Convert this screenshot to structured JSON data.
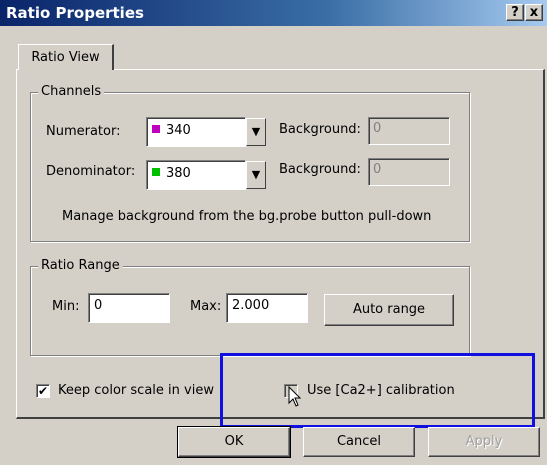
{
  "window": {
    "title": "Ratio Properties",
    "help_button": "?",
    "close_button": "x"
  },
  "tab": {
    "label": "Ratio View"
  },
  "channels": {
    "legend": "Channels",
    "numerator_label": "Numerator:",
    "numerator_value": "340",
    "numerator_color": "#c000c0",
    "numerator_bg_label": "Background:",
    "numerator_bg_value": "0",
    "denominator_label": "Denominator:",
    "denominator_value": "380",
    "denominator_color": "#00c000",
    "denominator_bg_label": "Background:",
    "denominator_bg_value": "0",
    "note": "Manage background from the bg.probe button pull-down"
  },
  "range": {
    "legend": "Ratio Range",
    "min_label": "Min:",
    "min_value": "0",
    "max_label": "Max:",
    "max_value": "2.000",
    "auto_button": "Auto range"
  },
  "options": {
    "keep_scale_label": "Keep color scale in view",
    "keep_scale_checked": true,
    "calibration_label": "Use [Ca2+] calibration",
    "calibration_checked": false
  },
  "buttons": {
    "ok": "OK",
    "cancel": "Cancel",
    "apply": "Apply"
  },
  "colors": {
    "title_bar": "#0a246a",
    "highlight_box": "#1010e0",
    "dialog_bg": "#d4d0c8"
  }
}
